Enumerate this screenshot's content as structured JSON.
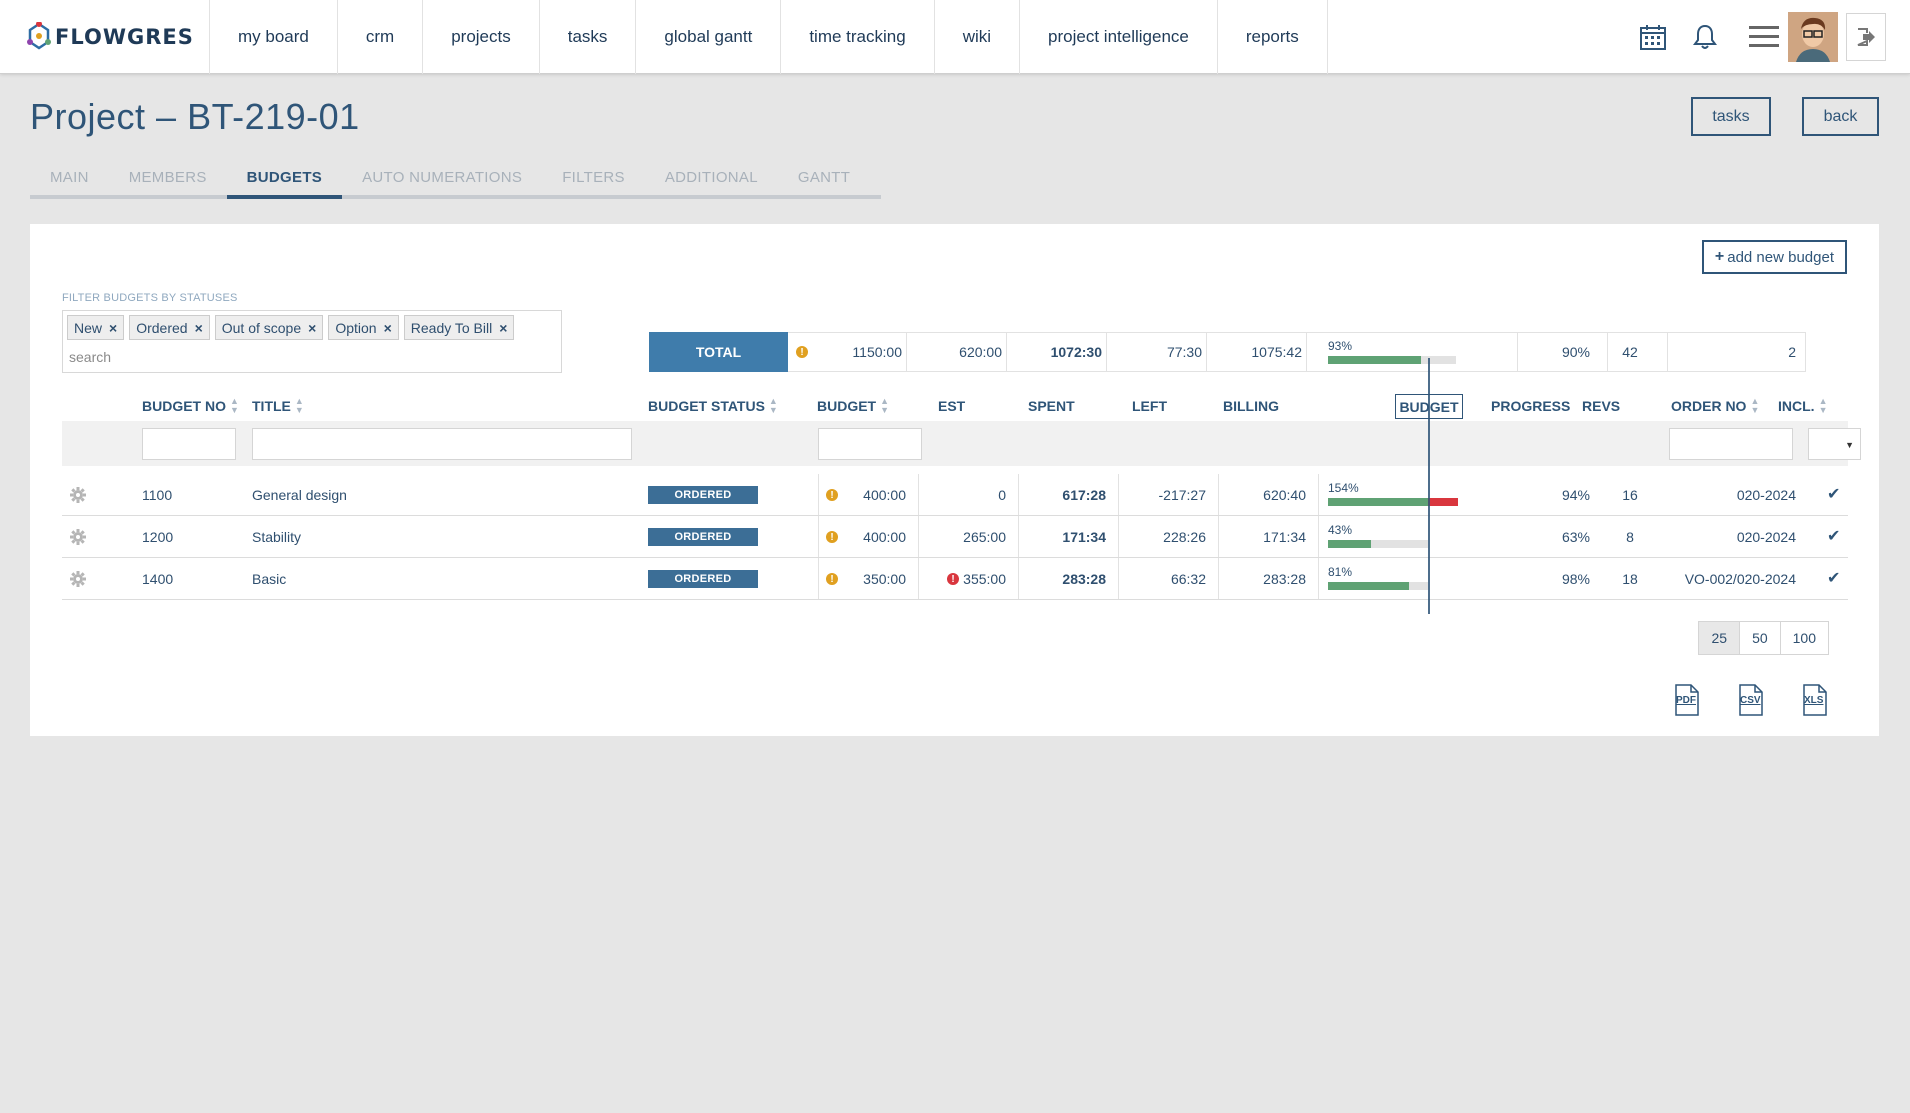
{
  "brand": {
    "name": "FLOWGRES"
  },
  "nav": [
    {
      "label": "my board"
    },
    {
      "label": "crm"
    },
    {
      "label": "projects"
    },
    {
      "label": "tasks"
    },
    {
      "label": "global gantt"
    },
    {
      "label": "time tracking"
    },
    {
      "label": "wiki"
    },
    {
      "label": "project intelligence"
    },
    {
      "label": "reports"
    }
  ],
  "page": {
    "title": "Project – BT-219-01",
    "tasks_label": "tasks",
    "back_label": "back"
  },
  "tabs": [
    {
      "label": "MAIN",
      "active": false
    },
    {
      "label": "MEMBERS",
      "active": false
    },
    {
      "label": "BUDGETS",
      "active": true
    },
    {
      "label": "AUTO NUMERATIONS",
      "active": false
    },
    {
      "label": "FILTERS",
      "active": false
    },
    {
      "label": "ADDITIONAL",
      "active": false
    },
    {
      "label": "GANTT",
      "active": false
    }
  ],
  "budgets": {
    "add_label": "add new budget",
    "filter_label": "FILTER BUDGETS BY STATUSES",
    "filter_chips": [
      "New",
      "Ordered",
      "Out of scope",
      "Option",
      "Ready To Bill"
    ],
    "filter_placeholder": "search",
    "total": {
      "label": "TOTAL",
      "budget": "1150:00",
      "est": "620:00",
      "spent": "1072:30",
      "left": "77:30",
      "billing": "1075:42",
      "budget_pct_label": "93%",
      "budget_pct": 93,
      "progress": "90%",
      "revs": "42",
      "incl": "2"
    },
    "columns": {
      "budget_no": "BUDGET NO",
      "title": "TITLE",
      "status": "BUDGET STATUS",
      "budget": "BUDGET",
      "est": "EST",
      "spent": "SPENT",
      "left": "LEFT",
      "billing": "BILLING",
      "budget_bar": "BUDGET",
      "progress": "PROGRESS",
      "revs": "REVS",
      "order_no": "ORDER NO",
      "incl": "INCL."
    },
    "rows": [
      {
        "no": "1100",
        "title": "General design",
        "status": "ORDERED",
        "budget": "400:00",
        "est": "0",
        "est_warn": false,
        "spent": "617:28",
        "left": "-217:27",
        "billing": "620:40",
        "pct_label": "154%",
        "pct": 154,
        "progress": "94%",
        "revs": "16",
        "order_no": "020-2024",
        "incl": true
      },
      {
        "no": "1200",
        "title": "Stability",
        "status": "ORDERED",
        "budget": "400:00",
        "est": "265:00",
        "est_warn": false,
        "spent": "171:34",
        "left": "228:26",
        "billing": "171:34",
        "pct_label": "43%",
        "pct": 43,
        "progress": "63%",
        "revs": "8",
        "order_no": "020-2024",
        "incl": true
      },
      {
        "no": "1400",
        "title": "Basic",
        "status": "ORDERED",
        "budget": "350:00",
        "est": "355:00",
        "est_warn": true,
        "spent": "283:28",
        "left": "66:32",
        "billing": "283:28",
        "pct_label": "81%",
        "pct": 81,
        "progress": "98%",
        "revs": "18",
        "order_no": "VO-002/020-2024",
        "incl": true
      }
    ],
    "page_sizes": [
      "25",
      "50",
      "100"
    ],
    "active_page_size": "25",
    "exports": [
      "PDF",
      "CSV",
      "XLS"
    ]
  },
  "colors": {
    "primary": "#2f5578",
    "total_bg": "#3f7cab",
    "bar_green": "#5fa274",
    "bar_red": "#d9363e",
    "warn_orange": "#e0a020"
  }
}
